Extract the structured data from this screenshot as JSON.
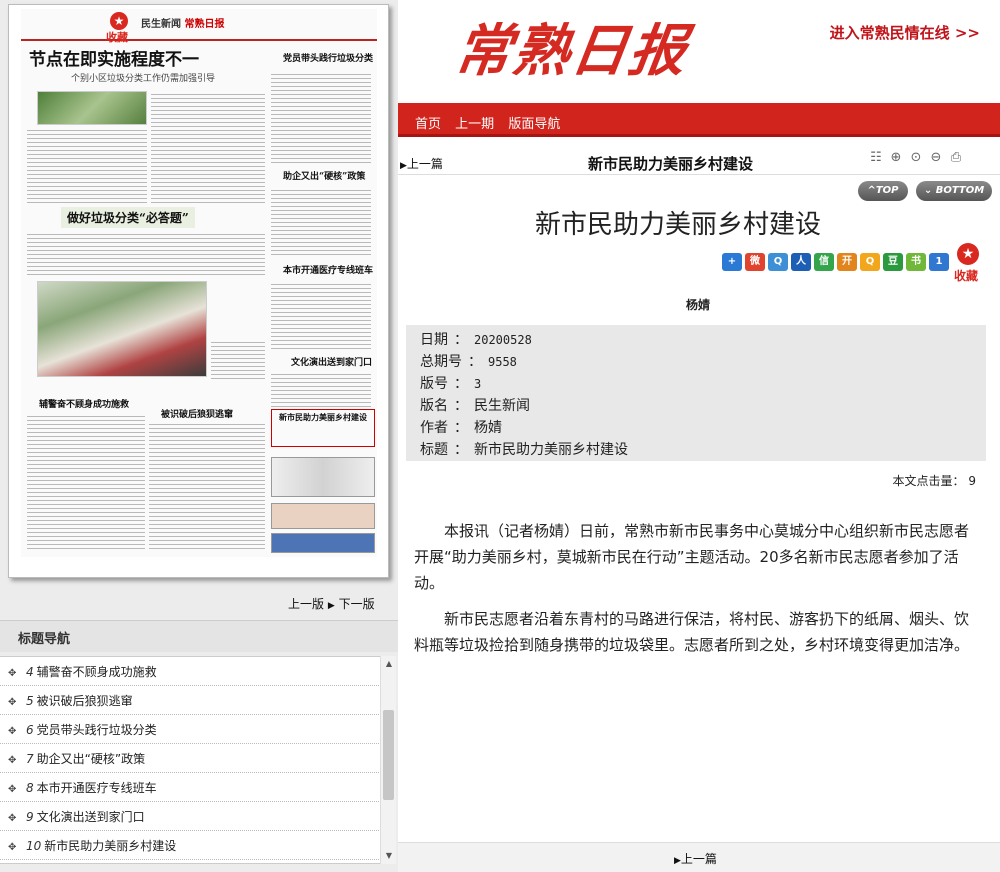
{
  "newspaper_page": {
    "favorite_label": "收藏",
    "section_header": "民生新闻",
    "paper_name": "常熟日报",
    "headline": "节点在即实施程度不一",
    "subheadline": "个别小区垃圾分类工作仍需加强引导",
    "headline_2": "做好垃圾分类“必答题”",
    "side_headline_1": "党员带头践行垃圾分类",
    "side_headline_2": "助企又出“硬核”政策",
    "side_headline_3": "本市开通医疗专线班车",
    "side_headline_4": "文化演出送到家门口",
    "bottom_headline_1": "辅警奋不顾身成功施救",
    "bottom_headline_2": "被识破后狼狈逃窜",
    "boxed_headline": "新市民助力美丽乡村建设"
  },
  "pager": {
    "prev": "上一版",
    "next": "下一版",
    "separator": "▶"
  },
  "title_nav": {
    "heading": "标题导航",
    "items": [
      {
        "num": "4",
        "label": "辅警奋不顾身成功施救"
      },
      {
        "num": "5",
        "label": "被识破后狼狈逃窜"
      },
      {
        "num": "6",
        "label": "党员带头践行垃圾分类"
      },
      {
        "num": "7",
        "label": "助企又出“硬核”政策"
      },
      {
        "num": "8",
        "label": "本市开通医疗专线班车"
      },
      {
        "num": "9",
        "label": "文化演出送到家门口"
      },
      {
        "num": "10",
        "label": "新市民助力美丽乡村建设"
      }
    ]
  },
  "masthead": {
    "logo": "常熟日报",
    "minqing_link": "进入常熟民情在线 >>"
  },
  "navbar": {
    "items": [
      "首页",
      "上一期",
      "版面导航"
    ]
  },
  "toolbar": {
    "prev_article": "上一篇",
    "title": "新市民助力美丽乡村建设",
    "top_label": "^TOP",
    "bottom_label": "BOTTOM"
  },
  "article": {
    "title": "新市民助力美丽乡村建设",
    "author": "杨婧",
    "favorite_label": "收藏",
    "meta": [
      {
        "label": "日期",
        "value": "20200528"
      },
      {
        "label": "总期号",
        "value": "9558"
      },
      {
        "label": "版号",
        "value": "3"
      },
      {
        "label": "版名",
        "value": "民生新闻"
      },
      {
        "label": "作者",
        "value": "杨婧"
      },
      {
        "label": "标题",
        "value": "新市民助力美丽乡村建设"
      }
    ],
    "meta_separator": "：",
    "click_label": "本文点击量：",
    "click_count": "9",
    "paragraphs": [
      "本报讯（记者杨婧）日前，常熟市新市民事务中心莫城分中心组织新市民志愿者开展“助力美丽乡村，莫城新市民在行动”主题活动。20多名新市民志愿者参加了活动。",
      "新市民志愿者沿着东青村的马路进行保洁，将村民、游客扔下的纸屑、烟头、饮料瓶等垃圾捡拾到随身携带的垃圾袋里。志愿者所到之处，乡村环境变得更加洁净。"
    ],
    "share_icons": [
      {
        "name": "add-share-icon",
        "glyph": "+",
        "color": "#2a7ad5"
      },
      {
        "name": "weibo-icon",
        "glyph": "微",
        "color": "#e0442e"
      },
      {
        "name": "qzone-icon",
        "glyph": "Q",
        "color": "#3d8fd6"
      },
      {
        "name": "renren-icon",
        "glyph": "人",
        "color": "#1d5fb5"
      },
      {
        "name": "wechat-icon",
        "glyph": "信",
        "color": "#34a54a"
      },
      {
        "name": "kaixin-icon",
        "glyph": "开",
        "color": "#e2851d"
      },
      {
        "name": "qq-icon",
        "glyph": "Q",
        "color": "#f1a61b"
      },
      {
        "name": "douban-icon",
        "glyph": "豆",
        "color": "#2b9a3e"
      },
      {
        "name": "bookmark-icon",
        "glyph": "书",
        "color": "#6fb83a"
      },
      {
        "name": "baidu-icon",
        "glyph": "1",
        "color": "#3077d2"
      }
    ]
  },
  "bottom_bar": {
    "prev_article": "上一篇"
  },
  "colors": {
    "brand_red": "#d0241d",
    "meta_bg": "#e8e8e8"
  }
}
